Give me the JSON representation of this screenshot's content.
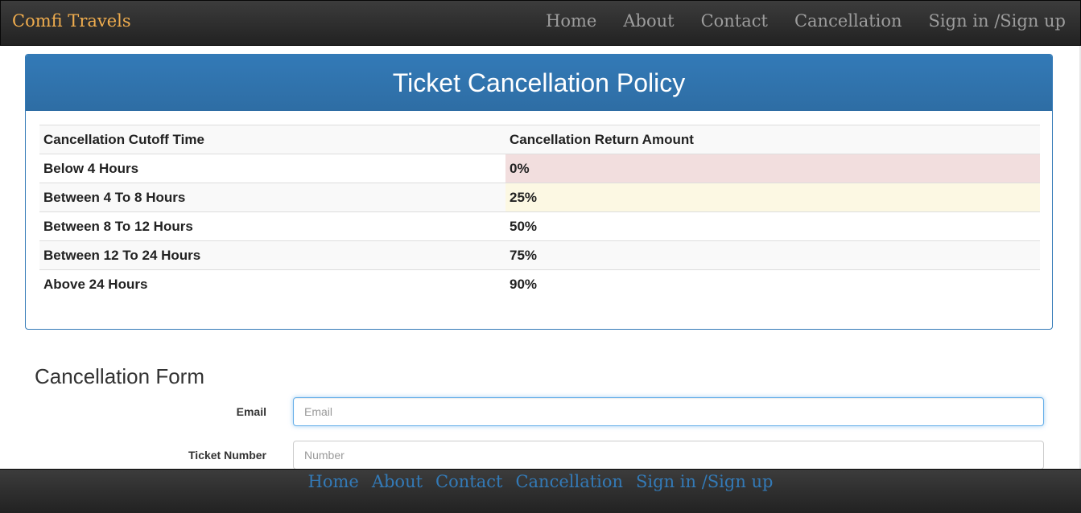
{
  "navbar": {
    "brand": "Comfi Travels",
    "links": [
      "Home",
      "About",
      "Contact",
      "Cancellation",
      "Sign in /Sign up"
    ]
  },
  "policy": {
    "title": "Ticket Cancellation Policy",
    "columns": [
      "Cancellation Cutoff Time",
      "Cancellation Return Amount"
    ],
    "rows": [
      [
        "Below 4 Hours",
        "0%"
      ],
      [
        "Between 4 To 8 Hours",
        "25%"
      ],
      [
        "Between 8 To 12 Hours",
        "50%"
      ],
      [
        "Between 12 To 24 Hours",
        "75%"
      ],
      [
        "Above 24 Hours",
        "90%"
      ]
    ]
  },
  "form": {
    "title": "Cancellation Form",
    "email_label": "Email",
    "email_placeholder": "Email",
    "ticket_label": "Ticket Number",
    "ticket_placeholder": "Number"
  },
  "footer": {
    "links": [
      "Home",
      "About",
      "Contact",
      "Cancellation",
      "Sign in /Sign up"
    ]
  },
  "colors": {
    "brand": "#f0ad4e",
    "primary": "#337ab7",
    "danger_bg": "#f2dede",
    "warning_bg": "#fcf8e3"
  }
}
